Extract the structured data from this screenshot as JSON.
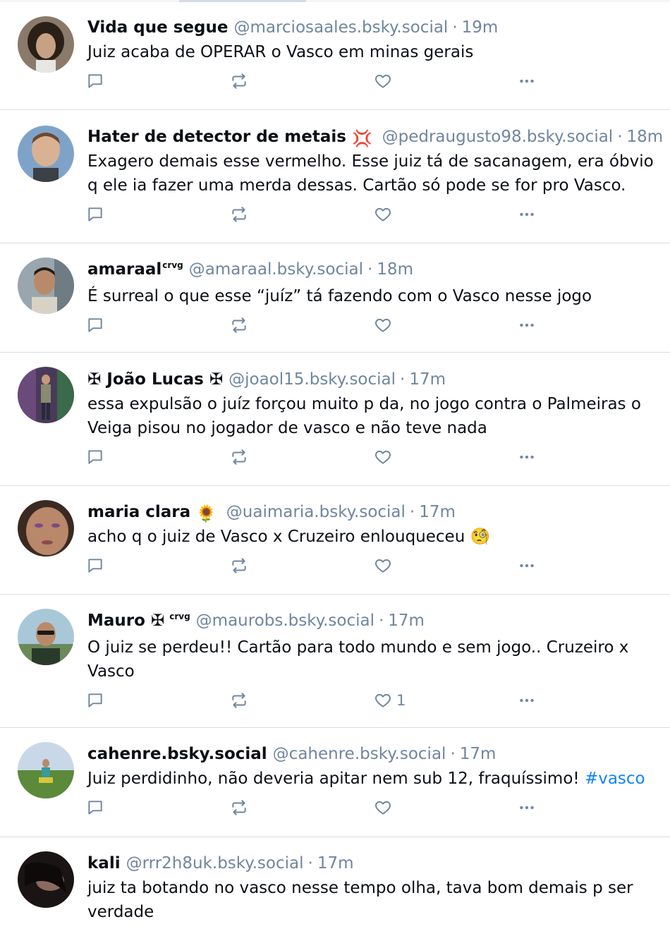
{
  "colors": {
    "text": "#0b0f14",
    "muted": "#6f869f",
    "link": "#1083fe",
    "divider": "#d8dde3"
  },
  "posts": [
    {
      "name": "Vida que segue",
      "name_suffix": "",
      "emoji": "",
      "handle": "@marciosaales.bsky.social",
      "time": "19m",
      "text": "Juiz acaba de OPERAR o Vasco em minas gerais",
      "hashtag": "",
      "likes": "",
      "avatar": "avatar-curly-hair"
    },
    {
      "name": "Hater de detector de metais",
      "name_suffix": "",
      "emoji": "💢",
      "handle": "@pedraugusto98.bsky.social",
      "time": "18m",
      "text": "Exagero demais esse vermelho. Esse juiz tá de sacanagem, era óbvio q ele ia fazer uma merda dessas. Cartão só pode se for pro Vasco.",
      "hashtag": "",
      "likes": "",
      "avatar": "avatar-selfie"
    },
    {
      "name": "amaraal",
      "name_suffix": "crvg",
      "emoji": "",
      "handle": "@amaraal.bsky.social",
      "time": "18m",
      "text": "É surreal o que esse “juíz” tá fazendo com o Vasco nesse jogo",
      "hashtag": "",
      "likes": "",
      "avatar": "avatar-portrait"
    },
    {
      "name": "✠ João Lucas ✠",
      "name_suffix": "",
      "emoji": "",
      "handle": "@joaol15.bsky.social",
      "time": "17m",
      "text": "essa expulsão o juíz forçou muito p da, no jogo contra o Palmeiras o Veiga pisou no jogador de vasco e não teve nada",
      "hashtag": "",
      "likes": "",
      "avatar": "avatar-standing"
    },
    {
      "name": "maria clara",
      "name_suffix": "",
      "emoji": "🌻",
      "handle": "@uaimaria.bsky.social",
      "time": "17m",
      "text": "acho q o juiz de Vasco x Cruzeiro enlouqueceu 🧐",
      "hashtag": "",
      "likes": "",
      "avatar": "avatar-closeup"
    },
    {
      "name": "Mauro ✠",
      "name_suffix": "crvg",
      "emoji": "",
      "handle": "@maurobs.bsky.social",
      "time": "17m",
      "text": "O juiz se perdeu!! Cartão para todo mundo e sem jogo..  Cruzeiro x Vasco",
      "hashtag": "",
      "likes": "1",
      "avatar": "avatar-sunglasses"
    },
    {
      "name": "cahenre.bsky.social",
      "name_suffix": "",
      "emoji": "",
      "handle": "@cahenre.bsky.social",
      "time": "17m",
      "text": "Juiz perdidinho, não deveria apitar nem sub 12, fraquíssimo! ",
      "hashtag": "#vasco",
      "likes": "",
      "avatar": "avatar-field"
    },
    {
      "name": "kali",
      "name_suffix": "",
      "emoji": "",
      "handle": "@rrr2h8uk.bsky.social",
      "time": "17m",
      "text": "juiz ta botando no vasco nesse tempo olha, tava bom demais p ser verdade",
      "hashtag": "",
      "likes": "",
      "avatar": "avatar-dark"
    }
  ]
}
